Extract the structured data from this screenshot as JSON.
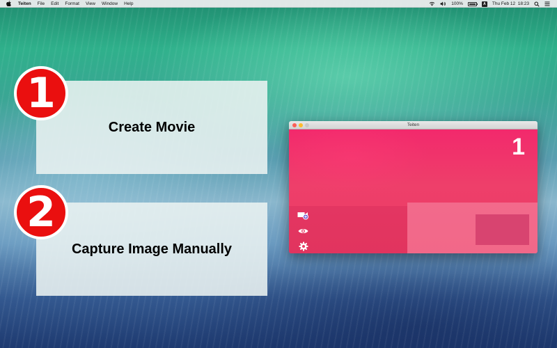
{
  "menubar": {
    "apple_icon": "apple-icon",
    "app_name": "Teiten",
    "items": [
      "File",
      "Edit",
      "Format",
      "View",
      "Window",
      "Help"
    ],
    "status": {
      "battery": "100%",
      "input_source": "A",
      "datetime": "Thu Feb 12  18:23"
    }
  },
  "steps": [
    {
      "number": "1",
      "label": "Create Movie"
    },
    {
      "number": "2",
      "label": "Capture Image Manually"
    }
  ],
  "window": {
    "title": "Teiten",
    "counter": "1",
    "tools": [
      "add-movie-icon",
      "eye-icon",
      "gear-icon"
    ]
  },
  "colors": {
    "badge": "#ea0f0f",
    "preview": "#f2296c"
  }
}
